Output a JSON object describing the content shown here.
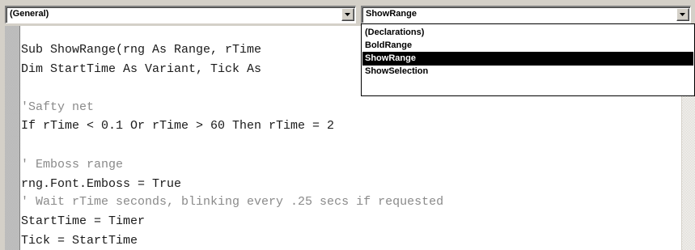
{
  "object_combo": {
    "value": "(General)"
  },
  "procedure_combo": {
    "value": "ShowRange"
  },
  "procedure_list": {
    "items": [
      "(Declarations)",
      "BoldRange",
      "ShowRange",
      "ShowSelection"
    ],
    "selected_index": 2
  },
  "code": {
    "lines": [
      {
        "text": "Sub ShowRange(rng As Range, rTime",
        "kind": "code"
      },
      {
        "text": "Dim StartTime As Variant, Tick As",
        "kind": "code"
      },
      {
        "text": "",
        "kind": "blank"
      },
      {
        "text": "'Safty net",
        "kind": "comment"
      },
      {
        "text": "If rTime < 0.1 Or rTime > 60 Then rTime = 2",
        "kind": "code"
      },
      {
        "text": "",
        "kind": "blank"
      },
      {
        "text": "' Emboss range",
        "kind": "comment"
      },
      {
        "text": "rng.Font.Emboss = True",
        "kind": "code"
      },
      {
        "text": "' Wait rTime seconds, blinking every .25 secs if requested",
        "kind": "comment"
      },
      {
        "text": "StartTime = Timer",
        "kind": "code"
      },
      {
        "text": "Tick = StartTime",
        "kind": "code"
      }
    ]
  },
  "icons": {
    "combo_button": "chevron-down-icon"
  },
  "colors": {
    "selection_bg": "#000000",
    "selection_fg": "#ffffff",
    "comment": "#8a8a8a",
    "code": "#1a1a1a"
  }
}
